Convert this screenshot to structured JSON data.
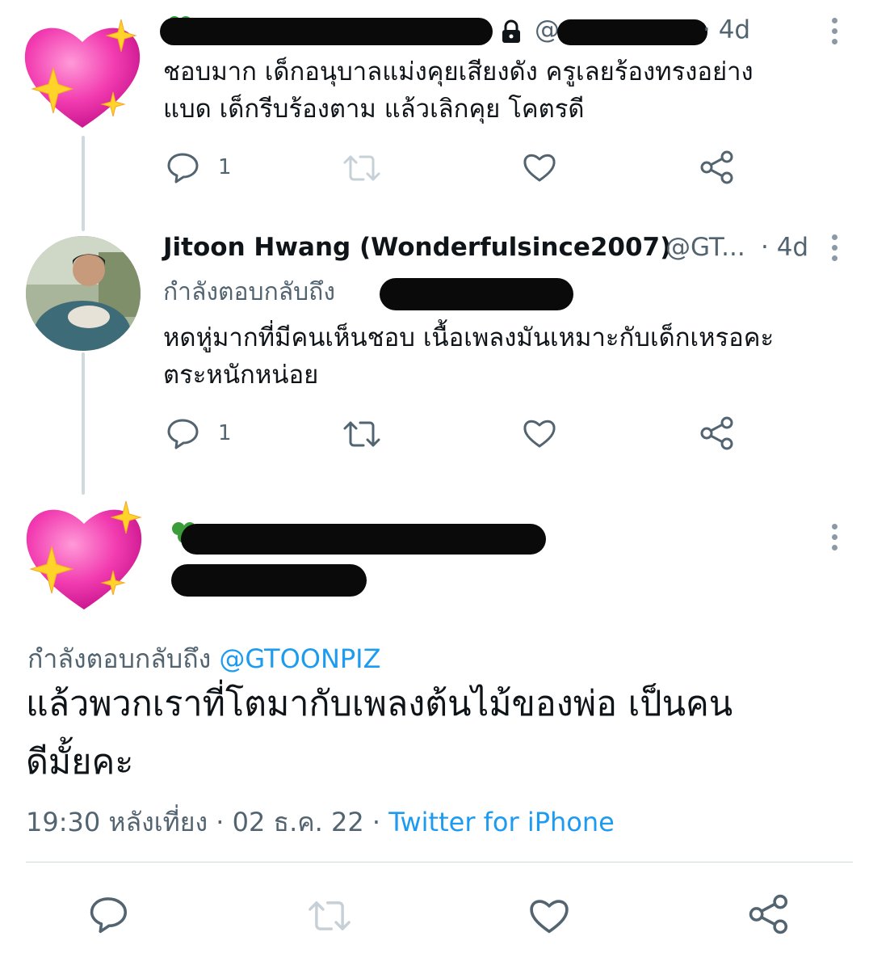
{
  "tweet1": {
    "handle_prefix": "@",
    "time": "· 4d",
    "text_line1": "ชอบมาก เด็กอนุบาลแม่งคุยเสียงดัง ครูเลยร้องทรงอย่าง",
    "text_line2": "แบด เด็กรีบร้องตาม แล้วเลิกคุย โคตรดี",
    "reply_count": "1"
  },
  "tweet2": {
    "name": "Jitoon Hwang (Wonderfulsince2007)",
    "handle": "@GT...",
    "time": "· 4d",
    "replying_label": "กำลังตอบกลับถึง",
    "text_line1": "หดหู่มากที่มีคนเห็นชอบ เนื้อเพลงมันเหมาะกับเด็กเหรอคะ",
    "text_line2": "ตระหนักหน่อย",
    "reply_count": "1"
  },
  "main_tweet": {
    "replying_label": "กำลังตอบกลับถึง",
    "replying_handle": "@GTOONPIZ",
    "text_line1": "แล้วพวกเราที่โตมากับเพลงต้นไม้ของพ่อ เป็นคน",
    "text_line2": "ดีมั้ยคะ",
    "timestamp": "19:30 หลังเที่ยง · 02 ธ.ค. 22 ·",
    "source": "Twitter for iPhone"
  },
  "colors": {
    "accent": "#1d9bf0",
    "muted": "#536471",
    "thread_line": "#cfd9de",
    "clover": "#3a9d3a"
  },
  "icons": [
    "reply-icon",
    "retweet-icon",
    "like-icon",
    "share-icon",
    "more-icon",
    "lock-icon",
    "clover-icon",
    "heart-sparkle-avatar"
  ]
}
